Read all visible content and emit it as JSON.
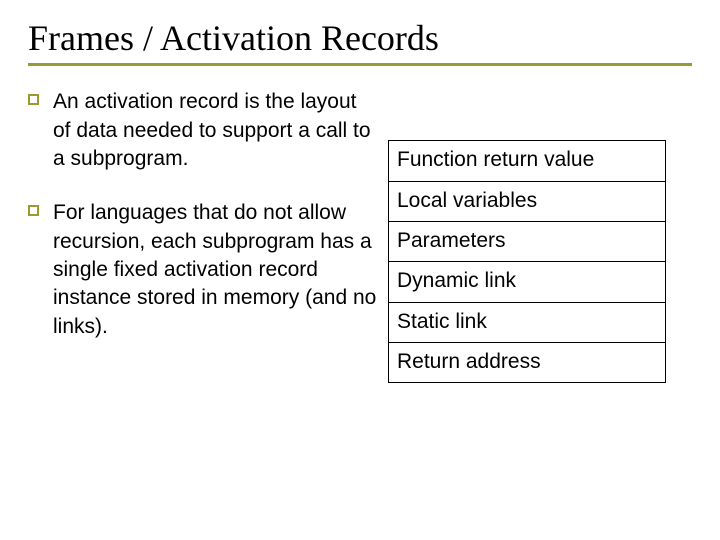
{
  "title": "Frames / Activation Records",
  "bullets": [
    "An activation record is the layout of data needed to support a call to a subprogram.",
    "For languages that do not allow recursion, each subprogram has a single fixed activation record instance stored in memory (and no links)."
  ],
  "record_rows": [
    "Function return value",
    "Local variables",
    "Parameters",
    "Dynamic link",
    "Static link",
    "Return address"
  ]
}
